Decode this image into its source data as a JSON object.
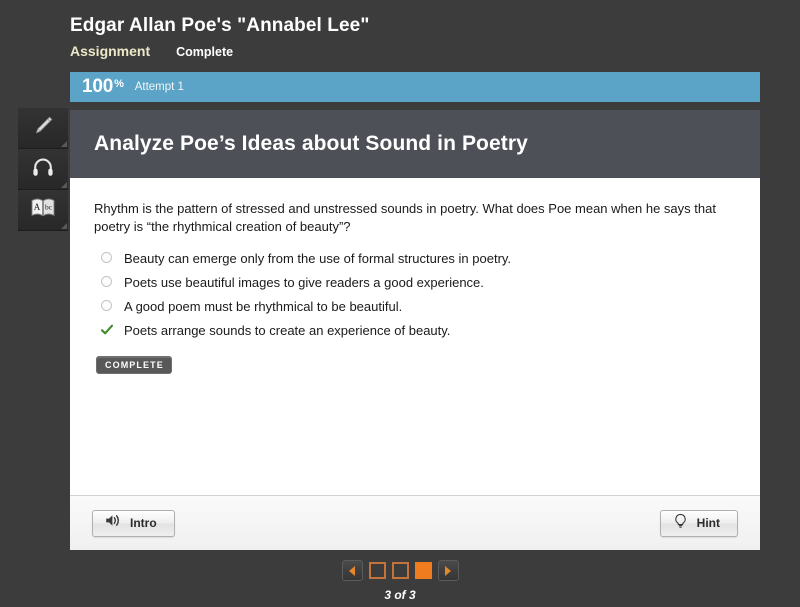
{
  "header": {
    "course_title": "Edgar Allan Poe's \"Annabel Lee\"",
    "tab_assignment": "Assignment",
    "tab_complete": "Complete"
  },
  "score_bar": {
    "percent": "100",
    "percent_sign": "%",
    "attempt": "Attempt 1",
    "color": "#5ba4c7"
  },
  "tool_rail": {
    "items": [
      {
        "icon": "highlighter-icon"
      },
      {
        "icon": "headphones-icon"
      },
      {
        "icon": "dictionary-icon"
      }
    ]
  },
  "panel": {
    "title": "Analyze Poe’s Ideas about Sound in Poetry",
    "question": "Rhythm is the pattern of stressed and unstressed sounds in poetry. What does Poe mean when he says that poetry is “the rhythmical creation of beauty”?",
    "options": [
      {
        "label": "Beauty can emerge only from the use of formal structures in poetry.",
        "selected": false
      },
      {
        "label": "Poets use beautiful images to give readers a good experience.",
        "selected": false
      },
      {
        "label": "A good poem must be rhythmical to be beautiful.",
        "selected": false
      },
      {
        "label": "Poets arrange sounds to create an experience of beauty.",
        "selected": true
      }
    ],
    "status_badge": "COMPLETE",
    "check_color": "#3f8a2e"
  },
  "footer": {
    "intro_label": "Intro",
    "hint_label": "Hint"
  },
  "pagination": {
    "prev_label": "◀",
    "next_label": "▶",
    "dots": [
      {
        "active": false
      },
      {
        "active": false
      },
      {
        "active": true
      }
    ],
    "count_label": "3 of 3",
    "accent": "#ef7d1f"
  }
}
